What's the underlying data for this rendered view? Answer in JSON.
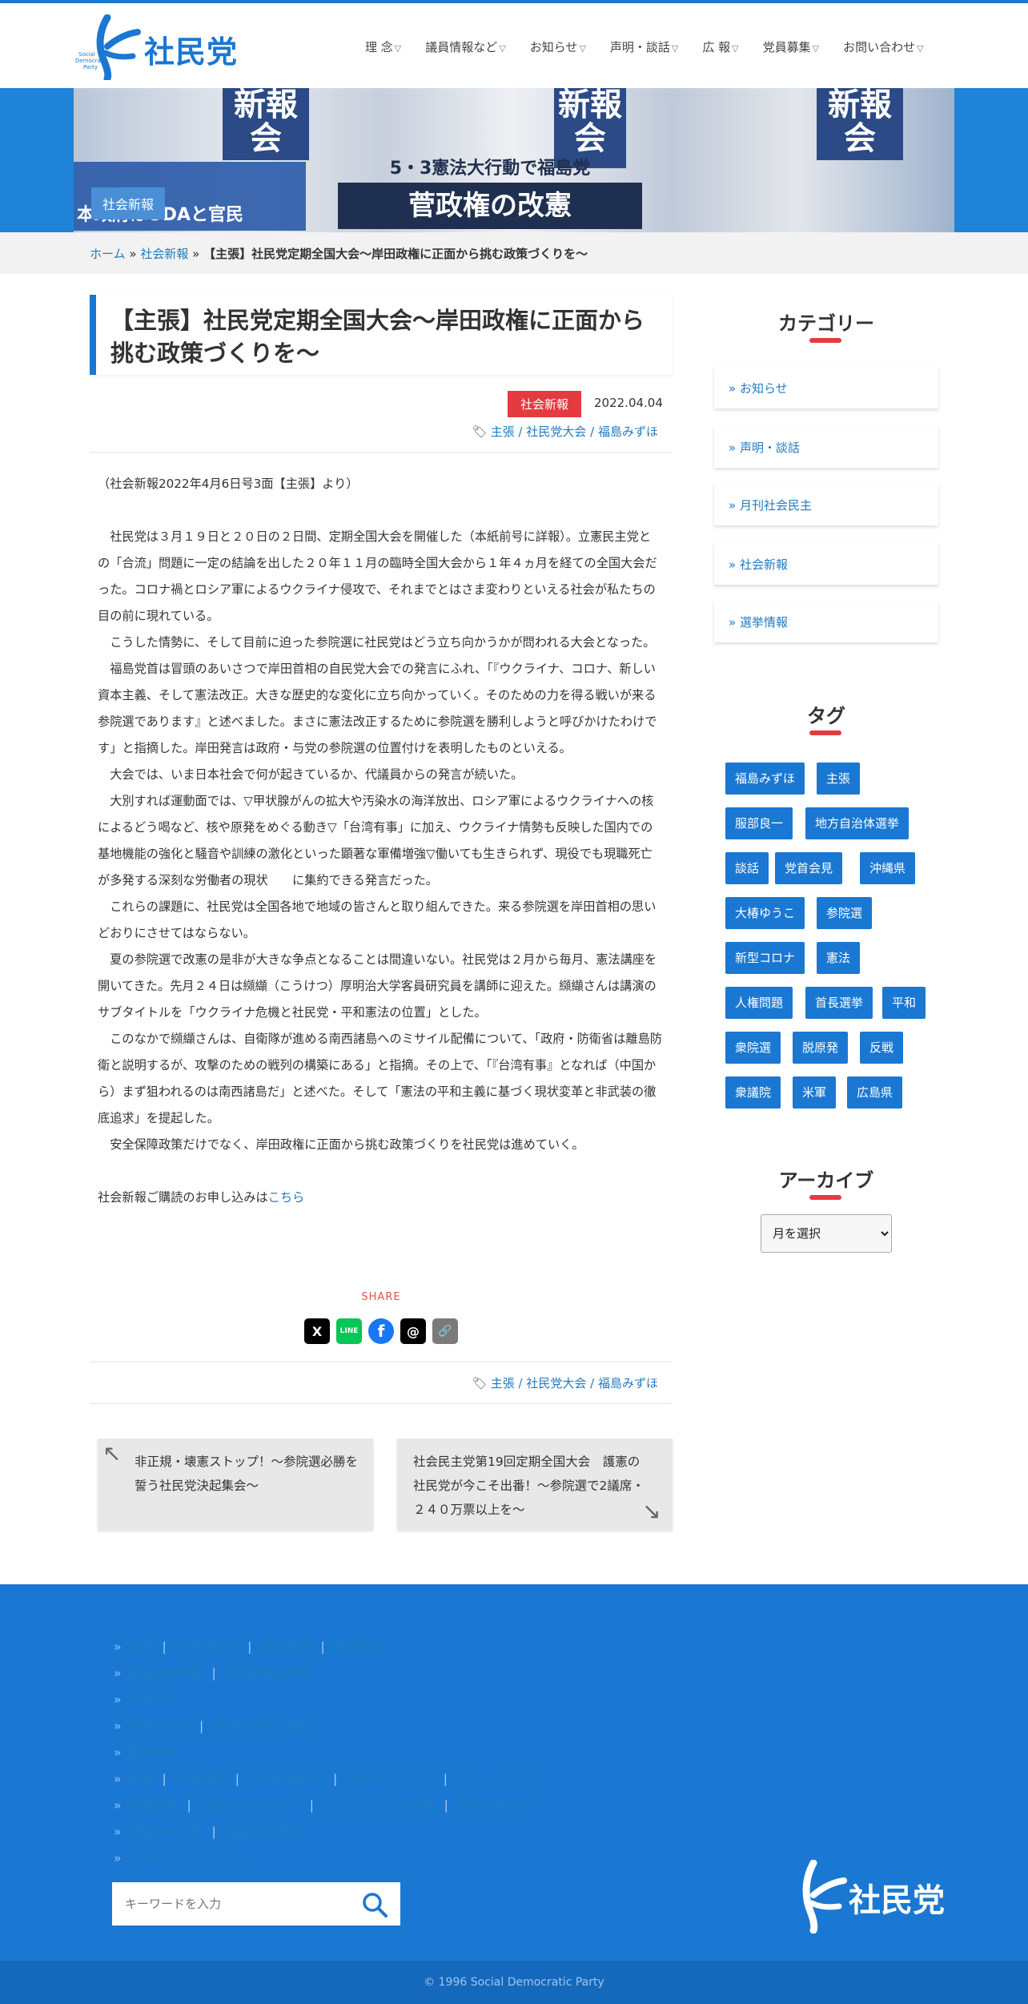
{
  "header": {
    "logo_text": "社民党",
    "logo_sub": "Social Democratic Party",
    "nav": [
      "理 念",
      "議員情報など",
      "お知らせ",
      "声明・談話",
      "広 報",
      "党員募集",
      "お問い合わせ"
    ]
  },
  "banner": {
    "label": "社会新報",
    "paper_text": "新報会",
    "headline": "菅政権の改憲",
    "subheadline": "5・3憲法大行動で福島党",
    "left_text": "本政府はODAと官民"
  },
  "breadcrumb": {
    "home": "ホーム",
    "sep": "»",
    "section": "社会新報",
    "current": "【主張】社民党定期全国大会〜岸田政権に正面から挑む政策づくりを〜"
  },
  "post": {
    "title": "【主張】社民党定期全国大会〜岸田政権に正面から挑む政策づくりを〜",
    "category": "社会新報",
    "date": "2022.04.04",
    "tags": [
      "主張",
      "社民党大会",
      "福島みずほ"
    ],
    "tag_sep": " / ",
    "source": "（社会新報2022年4月6日号3面【主張】より）",
    "paragraphs": [
      "　社民党は３月１９日と２０日の２日間、定期全国大会を開催した（本紙前号に詳報）。立憲民主党との「合流」問題に一定の結論を出した２０年１１月の臨時全国大会から１年４ヵ月を経ての全国大会だった。コロナ禍とロシア軍によるウクライナ侵攻で、それまでとはさま変わりといえる社会が私たちの目の前に現れている。",
      "　こうした情勢に、そして目前に迫った参院選に社民党はどう立ち向かうかが問われる大会となった。",
      "　福島党首は冒頭のあいさつで岸田首相の自民党大会での発言にふれ、「『ウクライナ、コロナ、新しい資本主義、そして憲法改正。大きな歴史的な変化に立ち向かっていく。そのための力を得る戦いが来る参院選であります』と述べました。まさに憲法改正するために参院選を勝利しようと呼びかけたわけです」と指摘した。岸田発言は政府・与党の参院選の位置付けを表明したものといえる。",
      "　大会では、いま日本社会で何が起きているか、代議員からの発言が続いた。",
      "　大別すれば運動面では、▽甲状腺がんの拡大や汚染水の海洋放出、ロシア軍によるウクライナへの核によるどう喝など、核や原発をめぐる動き▽「台湾有事」に加え、ウクライナ情勢も反映した国内での基地機能の強化と騒音や訓練の激化といった顕著な軍備増強▽働いても生きられず、現役でも現職死亡が多発する深刻な労働者の現状　　に集約できる発言だった。",
      "　これらの課題に、社民党は全国各地で地域の皆さんと取り組んできた。来る参院選を岸田首相の思いどおりにさせてはならない。",
      "　夏の参院選で改憲の是非が大きな争点となることは間違いない。社民党は２月から毎月、憲法講座を開いてきた。先月２４日は纐纈（こうけつ）厚明治大学客員研究員を講師に迎えた。纐纈さんは講演のサブタイトルを「ウクライナ危機と社民党・平和憲法の位置」とした。",
      "　このなかで纐纈さんは、自衛隊が進める南西諸島へのミサイル配備について、「政府・防衛省は離島防衛と説明するが、攻撃のための戦列の構築にある」と指摘。その上で、「『台湾有事』となれば（中国から）まず狙われるのは南西諸島だ」と述べた。そして「憲法の平和主義に基づく現状変革と非武装の徹底追求」を提起した。",
      "　安全保障政策だけでなく、岸田政権に正面から挑む政策づくりを社民党は進めていく。"
    ],
    "subscribe_text": "社会新報ご購読のお申し込みは",
    "subscribe_link": "こちら",
    "share_label": "SHARE",
    "share_buttons": [
      "X",
      "LINE",
      "f",
      "@",
      "🔗"
    ]
  },
  "prev_post": "非正規・壊憲ストップ！〜参院選必勝を誓う社民党決起集会〜",
  "next_post": "社会民主党第19回定期全国大会　護憲の社民党が今こそ出番！〜参院選で2議席・２４０万票以上を〜",
  "sidebar": {
    "category_heading": "カテゴリー",
    "categories": [
      "» お知らせ",
      "» 声明・談話",
      "» 月刊社会民主",
      "» 社会新報",
      "» 選挙情報"
    ],
    "tag_heading": "タグ",
    "tags": [
      "福島みずほ",
      "主張",
      "服部良一",
      "地方自治体選挙",
      "談話",
      "党首会見",
      "沖縄県",
      "大椿ゆうこ",
      "参院選",
      "新型コロナ",
      "憲法",
      "人権問題",
      "首長選挙",
      "平和",
      "衆院選",
      "脱原発",
      "反戦",
      "衆議院",
      "米軍",
      "広島県"
    ],
    "archive_heading": "アーカイブ",
    "archive_select": "月を選択"
  },
  "footer": {
    "bullet": "»",
    "sep": "|",
    "lines": [
      [
        "理念",
        "社民党宣言",
        "基本政策",
        "政策資料"
      ],
      [
        "国会議員情報",
        "自治体議員情報"
      ],
      [
        "お知らせ"
      ],
      [
        "声明・談話",
        "過去の声明・談話"
      ],
      [
        "選挙情報"
      ],
      [
        "広報",
        "社会新報",
        "月刊社会民主",
        "社民党ポスター",
        "ダウンロード"
      ],
      [
        "党員募集",
        "社民党サポーター",
        "ボランティア大募集",
        "寄付のお願い"
      ],
      [
        "お問い合わせ",
        "全国の社民党"
      ],
      [
        "プライバシーポリシー"
      ]
    ],
    "search_placeholder": "キーワードを入力",
    "logo_text": "社民党",
    "copyright": "© 1996 Social Democratic Party"
  },
  "colors": {
    "brand_blue": "#1a78d2",
    "accent_red": "#e53a40",
    "link": "#1f7bbf"
  }
}
